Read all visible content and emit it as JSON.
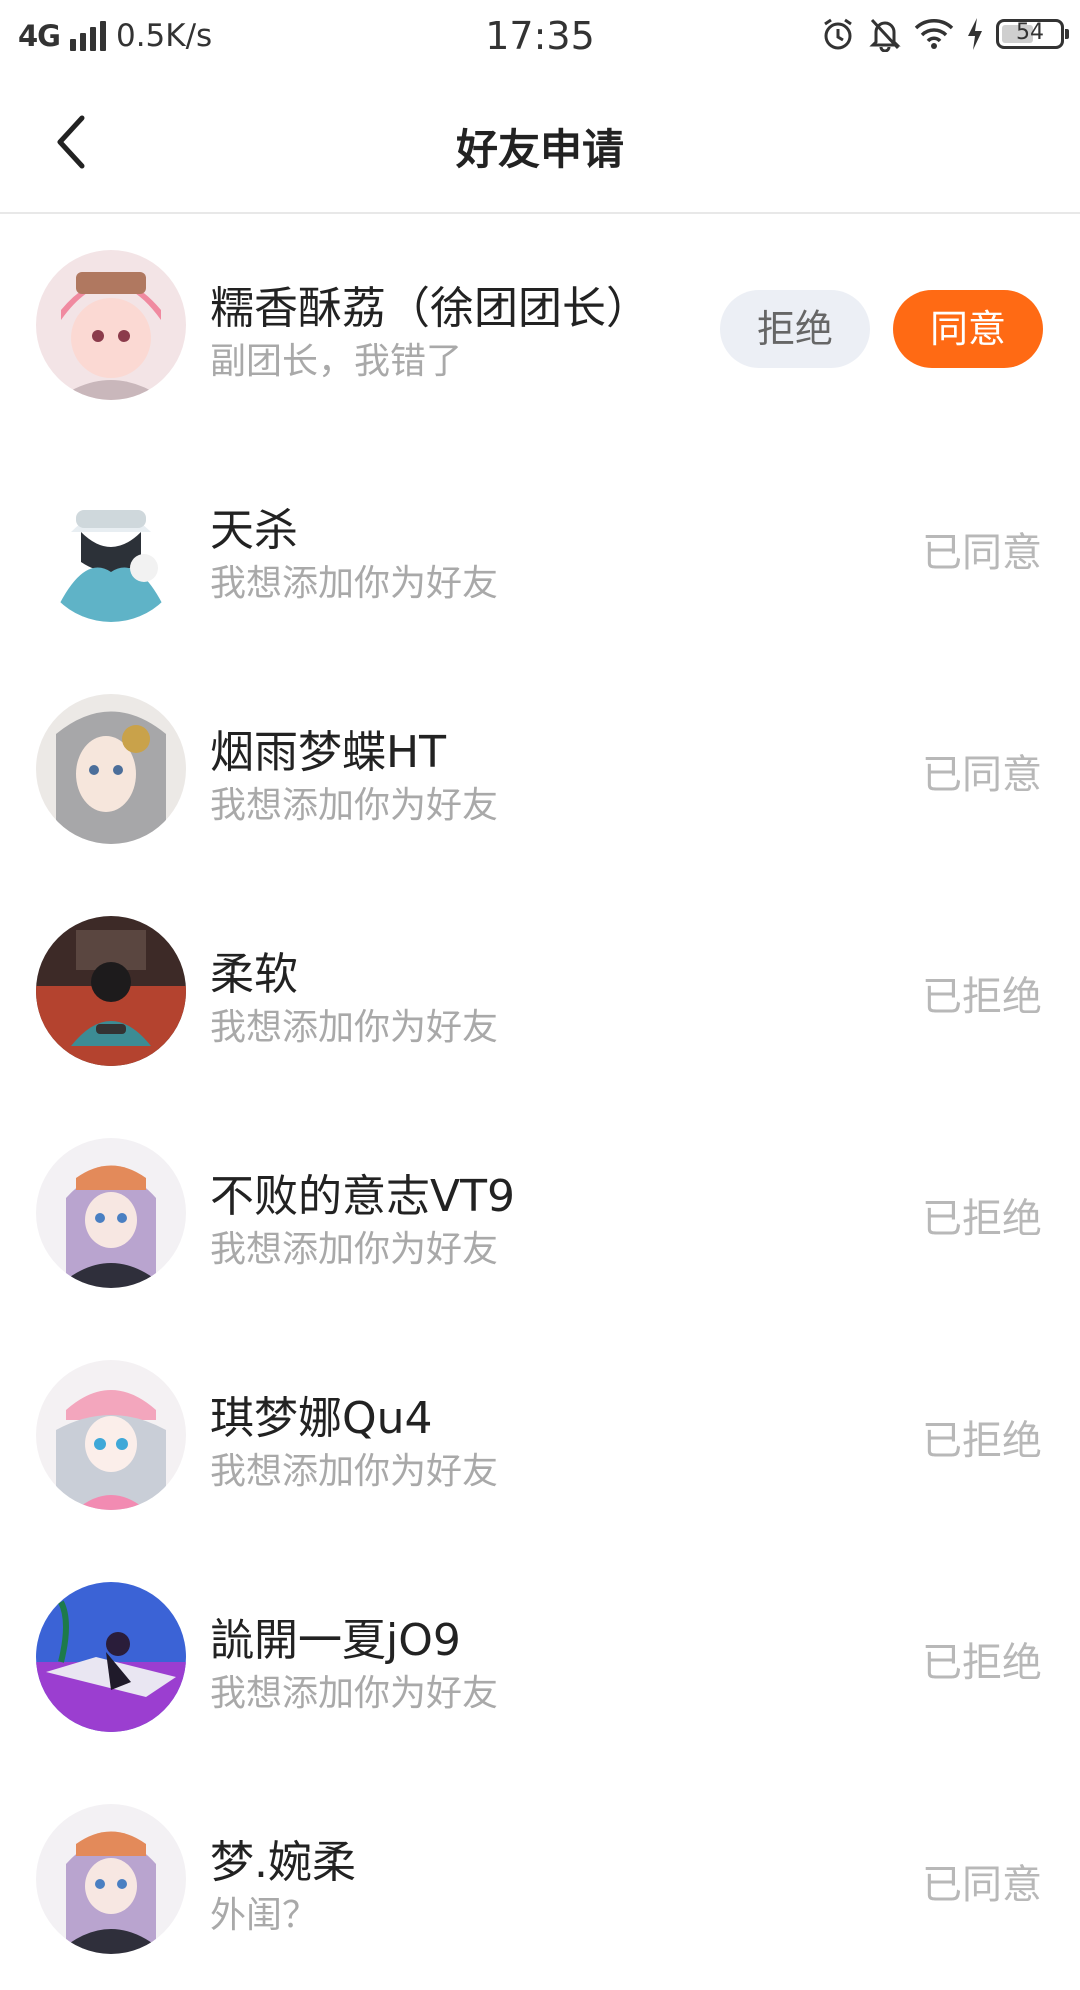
{
  "status_bar": {
    "network": "4G",
    "speed": "0.5K/s",
    "time": "17:35",
    "battery": "54",
    "icons": [
      "alarm-icon",
      "mute-bell-icon",
      "wifi-icon",
      "charging-icon",
      "battery-icon"
    ]
  },
  "header": {
    "title": "好友申请",
    "back_icon": "chevron-left-icon"
  },
  "colors": {
    "accent": "#ff6a14",
    "reject_bg": "#eceff5",
    "muted_text": "#a9a9a9",
    "status_text": "#b8b8b8"
  },
  "requests": [
    {
      "name": "糯香酥荔（徐团团长）",
      "message": "副团长，我错了",
      "reject_label": "拒绝",
      "accept_label": "同意"
    },
    {
      "name": "天杀",
      "message": "我想添加你为好友",
      "status": "已同意"
    },
    {
      "name": "烟雨梦蝶HT",
      "message": "我想添加你为好友",
      "status": "已同意"
    },
    {
      "name": "柔软",
      "message": "我想添加你为好友",
      "status": "已拒绝"
    },
    {
      "name": "不败的意志VT9",
      "message": "我想添加你为好友",
      "status": "已拒绝"
    },
    {
      "name": "琪梦娜Qu4",
      "message": "我想添加你为好友",
      "status": "已拒绝"
    },
    {
      "name": "詤開一夏jO9",
      "message": "我想添加你为好友",
      "status": "已拒绝"
    },
    {
      "name": "梦.婉柔",
      "message": "外闺？",
      "status": "已同意"
    }
  ]
}
